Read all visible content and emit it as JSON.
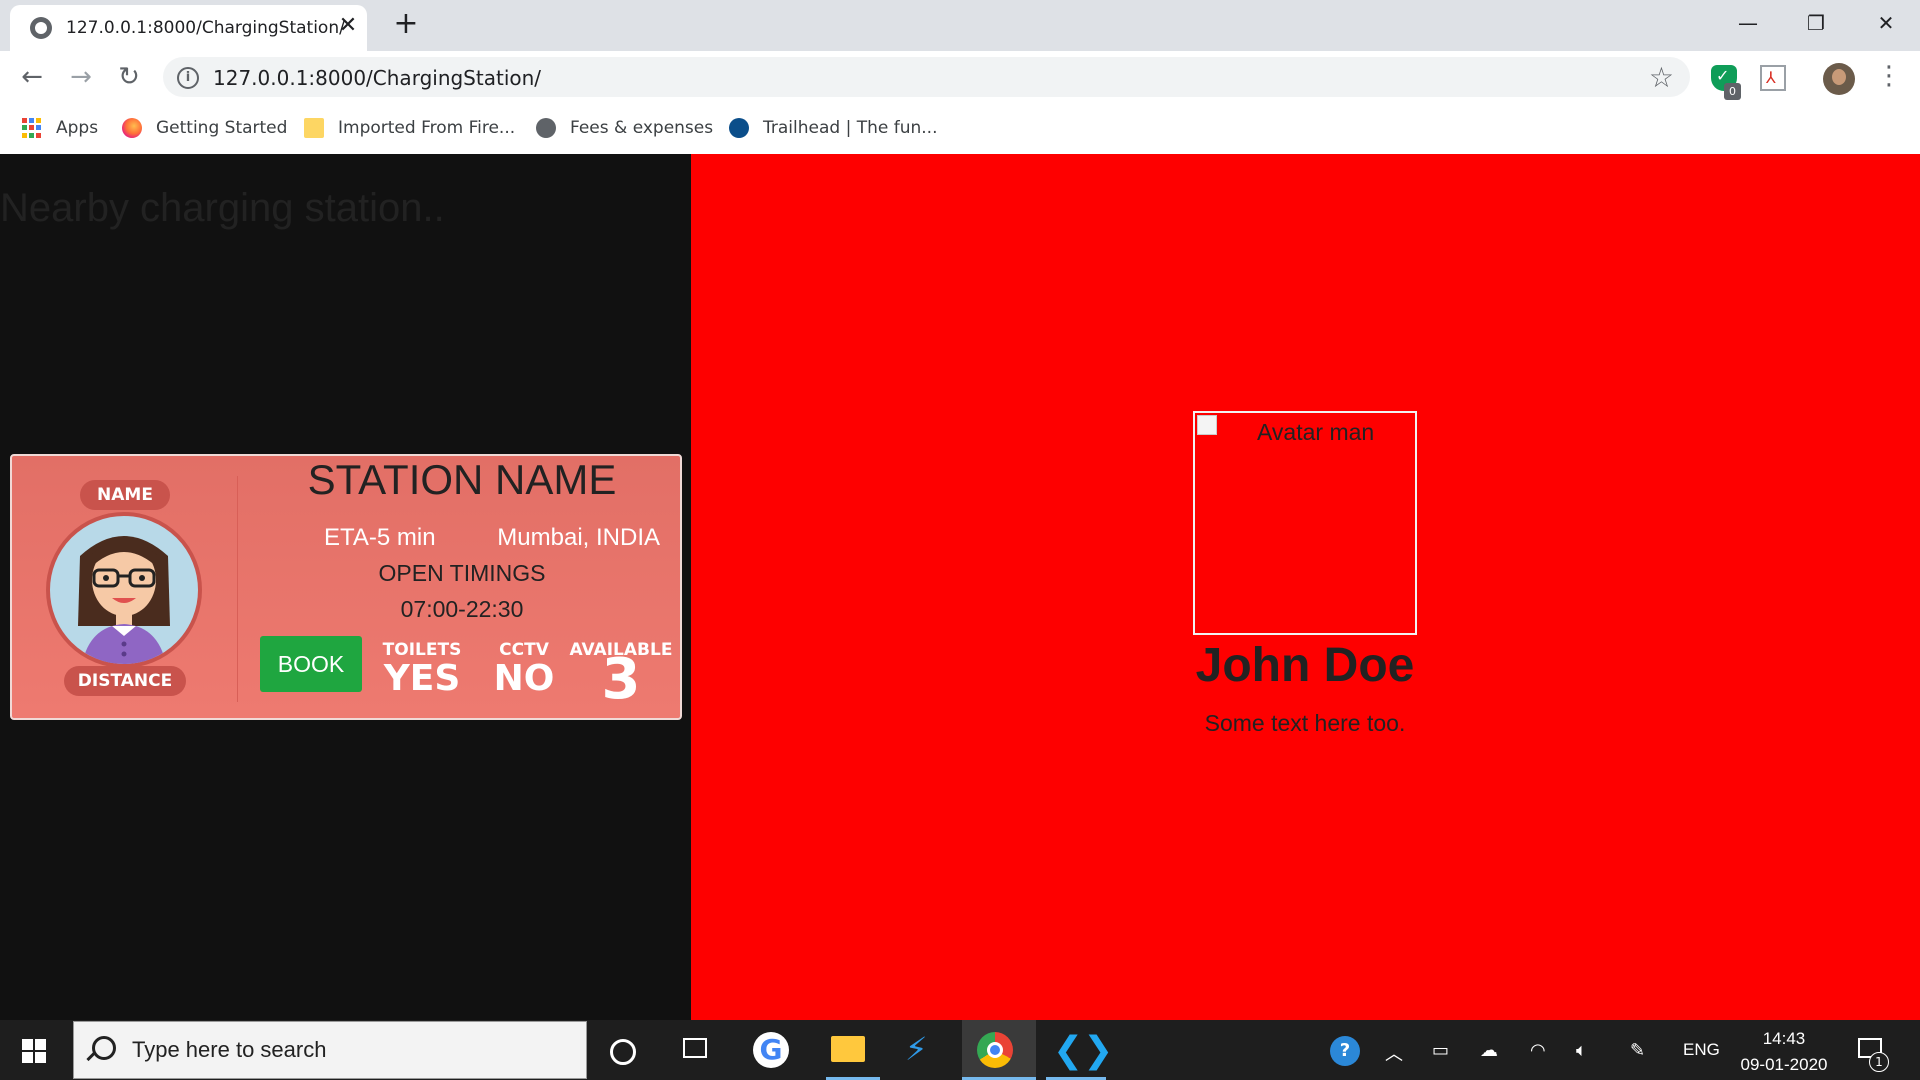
{
  "browser": {
    "tab_title": "127.0.0.1:8000/ChargingStation/",
    "url": "127.0.0.1:8000/ChargingStation/",
    "extension_badge": "0",
    "bookmarks": [
      {
        "label": "Apps"
      },
      {
        "label": "Getting Started"
      },
      {
        "label": "Imported From Fire..."
      },
      {
        "label": "Fees & expenses"
      },
      {
        "label": "Trailhead | The fun..."
      }
    ]
  },
  "page": {
    "heading": "Nearby charging station..",
    "colors": {
      "left_bg": "#111111",
      "right_bg": "#fe0000",
      "card_bg": "#e8736a",
      "book_green": "#1fa640"
    },
    "card": {
      "name_pill": "NAME",
      "distance_pill": "DISTANCE",
      "station_name": "STATION NAME",
      "eta": "ETA-5 min",
      "city": "Mumbai, INDIA",
      "timings_label": "OPEN TIMINGS",
      "timings_value": "07:00-22:30",
      "book_label": "BOOK",
      "toilets_label": "TOILETS",
      "toilets_value": "YES",
      "cctv_label": "CCTV",
      "cctv_value": "NO",
      "available_label": "AVAILABLE",
      "available_value": "3"
    },
    "profile": {
      "image_alt": "Avatar man",
      "name": "John Doe",
      "text": "Some text here too."
    }
  },
  "taskbar": {
    "search_placeholder": "Type here to search",
    "language": "ENG",
    "time": "14:43",
    "date": "09-01-2020",
    "notification_count": "1"
  }
}
